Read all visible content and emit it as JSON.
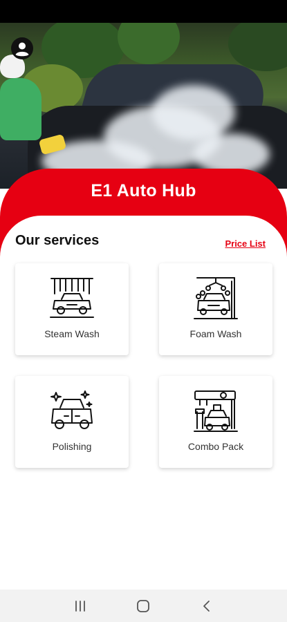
{
  "app": {
    "title": "E1 Auto Hub"
  },
  "services": {
    "heading": "Our services",
    "price_link": "Price List",
    "items": [
      {
        "label": "Steam Wash",
        "icon": "steam-wash-icon"
      },
      {
        "label": "Foam Wash",
        "icon": "foam-wash-icon"
      },
      {
        "label": "Polishing",
        "icon": "polishing-icon"
      },
      {
        "label": "Combo Pack",
        "icon": "combo-pack-icon"
      }
    ]
  },
  "colors": {
    "accent": "#e60012",
    "background": "#ffffff",
    "nav_bar": "#f2f2f2"
  },
  "icons": {
    "profile": "profile-icon",
    "nav_recent": "recent-apps-icon",
    "nav_home": "home-icon",
    "nav_back": "back-icon"
  }
}
